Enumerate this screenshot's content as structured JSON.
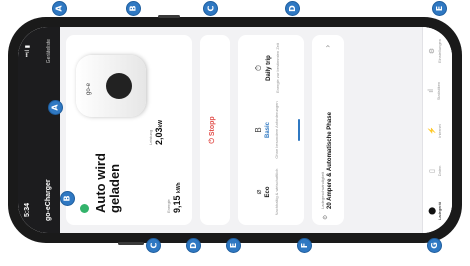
{
  "markers": {
    "top": [
      "A",
      "B",
      "C",
      "D",
      "E"
    ],
    "bottom": [
      "C",
      "D",
      "E",
      "F",
      "G"
    ],
    "inner_a": "A",
    "inner_b": "B"
  },
  "status_bar": {
    "time": "5:34",
    "signal": "••ıl ▮"
  },
  "header": {
    "app_name": "go-eCharger",
    "device_settings": "Geräteliste"
  },
  "status_card": {
    "state": "Auto wird geladen",
    "brand": "go-e",
    "power_label": "Leistung",
    "power_value": "2,03",
    "power_unit": "kW",
    "energy_label": "Energie",
    "energy_value": "9,15",
    "energy_unit": "kWh"
  },
  "stop_button": {
    "label": "⏻ Stopp"
  },
  "modes": [
    {
      "name": "Eco",
      "icon": "⌀",
      "description": "Nachhaltig & wirtschaftlich"
    },
    {
      "name": "Basic",
      "icon": "B",
      "description": "Ohne besondere Anforderungen"
    },
    {
      "name": "Daily trip",
      "icon": "⏱",
      "description": "Energie zur bestimmten Zeit"
    }
  ],
  "current_card": {
    "label": "Ladegeschwindigkeit",
    "value": "20 Ampere & Automatische Phase",
    "icon": "⚙"
  },
  "bottom_nav": [
    {
      "label": "Ladegerät",
      "icon": "⬤"
    },
    {
      "label": "Daten",
      "icon": "▯"
    },
    {
      "label": "Internet",
      "icon": "⚡"
    },
    {
      "label": "Statistiken",
      "icon": "ıl"
    },
    {
      "label": "Einstellungen",
      "icon": "⚙"
    }
  ],
  "colors": {
    "accent": "#2f78c2",
    "stop": "#e2534f",
    "charging": "#33b36b",
    "frame": "#1a1a1a"
  }
}
